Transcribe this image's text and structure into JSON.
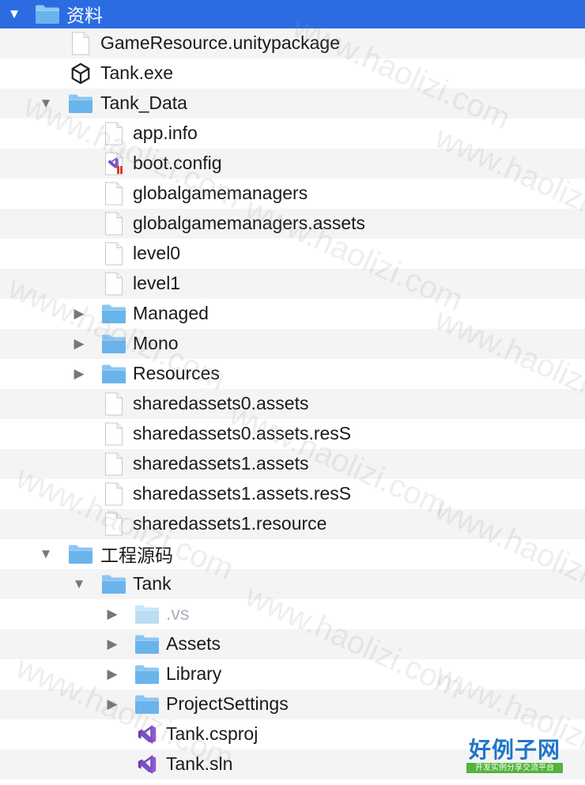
{
  "tree": {
    "root": {
      "label": "资料",
      "expanded": true
    },
    "items": [
      {
        "label": "GameResource.unitypackage",
        "icon": "file-icon"
      },
      {
        "label": "Tank.exe",
        "icon": "unity-icon"
      },
      {
        "label": "Tank_Data",
        "icon": "folder-icon",
        "expanded": true
      },
      {
        "label": "app.info",
        "icon": "file-icon"
      },
      {
        "label": "boot.config",
        "icon": "visual-studio-config-icon"
      },
      {
        "label": "globalgamemanagers",
        "icon": "file-icon"
      },
      {
        "label": "globalgamemanagers.assets",
        "icon": "file-icon"
      },
      {
        "label": "level0",
        "icon": "file-icon"
      },
      {
        "label": "level1",
        "icon": "file-icon"
      },
      {
        "label": "Managed",
        "icon": "folder-icon",
        "expanded": false
      },
      {
        "label": "Mono",
        "icon": "folder-icon",
        "expanded": false
      },
      {
        "label": "Resources",
        "icon": "folder-icon",
        "expanded": false
      },
      {
        "label": "sharedassets0.assets",
        "icon": "file-icon"
      },
      {
        "label": "sharedassets0.assets.resS",
        "icon": "file-icon"
      },
      {
        "label": "sharedassets1.assets",
        "icon": "file-icon"
      },
      {
        "label": "sharedassets1.assets.resS",
        "icon": "file-icon"
      },
      {
        "label": "sharedassets1.resource",
        "icon": "file-icon"
      },
      {
        "label": "工程源码",
        "icon": "folder-icon",
        "expanded": true
      },
      {
        "label": "Tank",
        "icon": "folder-icon",
        "expanded": true
      },
      {
        "label": ".vs",
        "icon": "hidden-folder-icon",
        "expanded": false
      },
      {
        "label": "Assets",
        "icon": "folder-icon",
        "expanded": false
      },
      {
        "label": "Library",
        "icon": "folder-icon",
        "expanded": false
      },
      {
        "label": "ProjectSettings",
        "icon": "folder-icon",
        "expanded": false
      },
      {
        "label": "Tank.csproj",
        "icon": "visual-studio-icon"
      },
      {
        "label": "Tank.sln",
        "icon": "visual-studio-icon"
      }
    ]
  },
  "watermark": "www.haolizi.com",
  "logo": {
    "title": "好例子网",
    "subtitle": "开发实例分享交流平台"
  },
  "colors": {
    "selection": "#2c6ce3",
    "folder": "#6cb6ee",
    "alt_row": "#f4f4f5"
  }
}
